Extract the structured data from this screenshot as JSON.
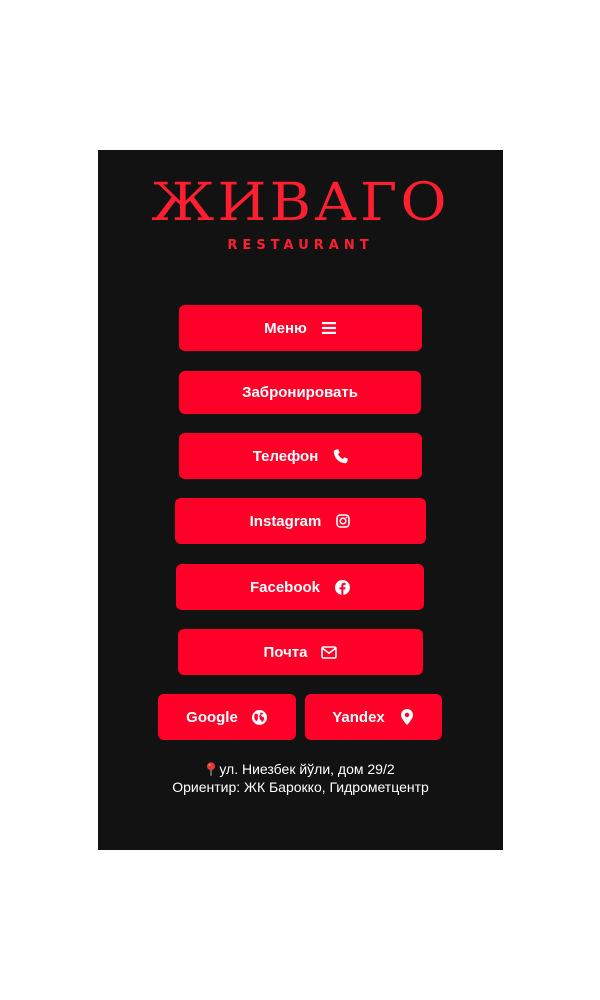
{
  "brand": {
    "name": "ЖИВАГО",
    "tagline": "RESTAURANT"
  },
  "buttons": {
    "menu": {
      "label": "Меню",
      "icon": "bars-icon"
    },
    "reserve": {
      "label": "Забронировать"
    },
    "phone": {
      "label": "Телефон",
      "icon": "phone-icon"
    },
    "instagram": {
      "label": "Instagram",
      "icon": "instagram-icon"
    },
    "facebook": {
      "label": "Facebook",
      "icon": "facebook-icon"
    },
    "mail": {
      "label": "Почта",
      "icon": "envelope-icon"
    },
    "google": {
      "label": "Google",
      "icon": "globe-icon"
    },
    "yandex": {
      "label": "Yandex",
      "icon": "map-marker-icon"
    }
  },
  "address": {
    "line1": "ул. Ниезбек йўли, дом 29/2",
    "line2": "Ориентир: ЖК Барокко, Гидрометцентр"
  },
  "colors": {
    "background": "#121212",
    "accent": "#ff0029",
    "logo": "#ff1f30",
    "text": "#ffffff"
  }
}
